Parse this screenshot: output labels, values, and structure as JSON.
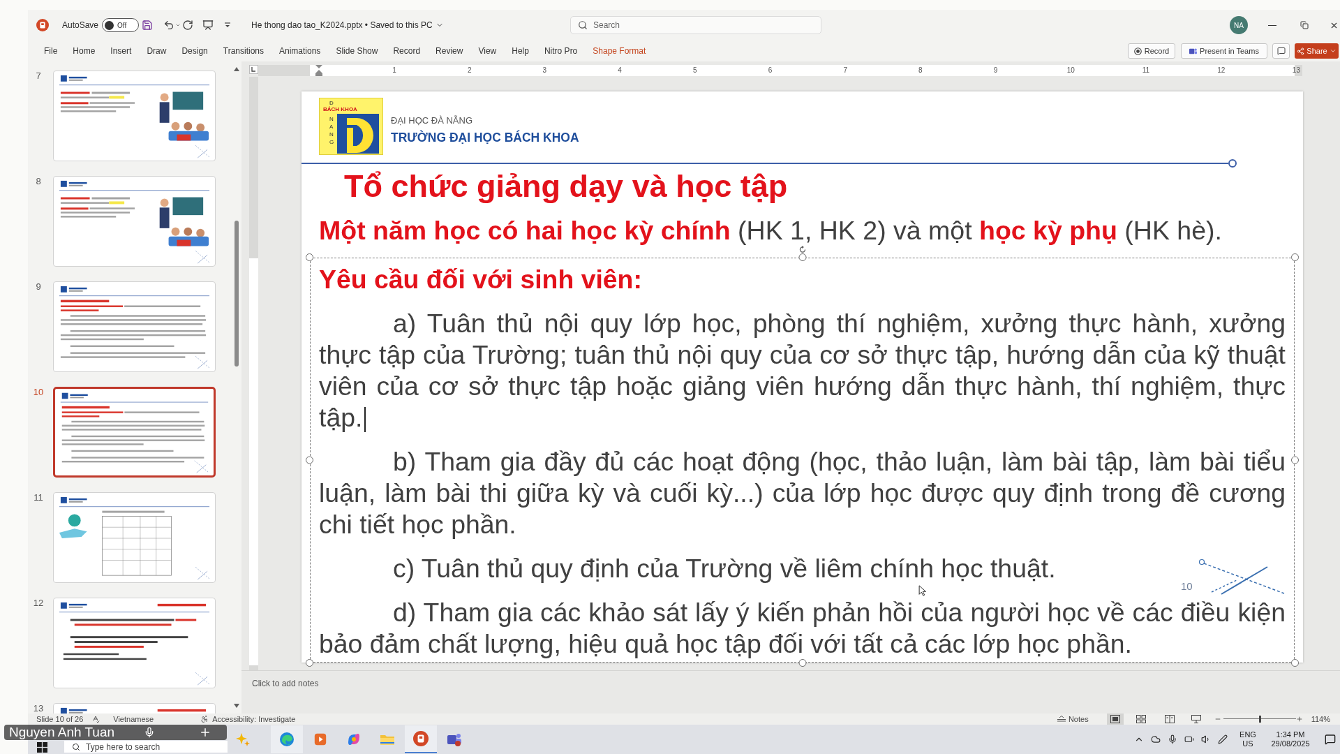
{
  "title_bar": {
    "autosave": {
      "label": "AutoSave",
      "on": false,
      "state_text": "Off"
    },
    "document": "He thong dao tao_K2024.pptx • Saved to this PC",
    "search": {
      "placeholder": "Search"
    },
    "avatar": "NA"
  },
  "ribbon": {
    "tabs": [
      {
        "label": "File",
        "kind": "standard"
      },
      {
        "label": "Home",
        "kind": "standard"
      },
      {
        "label": "Insert",
        "kind": "standard"
      },
      {
        "label": "Draw",
        "kind": "standard"
      },
      {
        "label": "Design",
        "kind": "standard"
      },
      {
        "label": "Transitions",
        "kind": "standard"
      },
      {
        "label": "Animations",
        "kind": "standard"
      },
      {
        "label": "Slide Show",
        "kind": "standard"
      },
      {
        "label": "Record",
        "kind": "standard"
      },
      {
        "label": "Review",
        "kind": "standard"
      },
      {
        "label": "View",
        "kind": "standard"
      },
      {
        "label": "Help",
        "kind": "standard"
      },
      {
        "label": "Nitro Pro",
        "kind": "standard"
      },
      {
        "label": "Shape Format",
        "kind": "contextual"
      }
    ],
    "actions": [
      {
        "kind": "record",
        "label": "Record"
      },
      {
        "kind": "teams",
        "label": "Present in Teams"
      },
      {
        "kind": "comments"
      },
      {
        "kind": "share",
        "label": "Share"
      }
    ]
  },
  "ruler": {
    "labels": [
      "1",
      "2",
      "3",
      "4",
      "5",
      "6",
      "7",
      "8",
      "9",
      "10",
      "11",
      "12",
      "13"
    ]
  },
  "thumbnails": [
    {
      "number": "7",
      "kind": "picture",
      "selected": false
    },
    {
      "number": "8",
      "kind": "picture",
      "selected": false
    },
    {
      "number": "9",
      "kind": "text",
      "selected": false
    },
    {
      "number": "10",
      "kind": "text",
      "selected": true
    },
    {
      "number": "11",
      "kind": "table",
      "selected": false
    },
    {
      "number": "12",
      "kind": "list",
      "selected": false
    },
    {
      "number": "13",
      "kind": "list",
      "selected": false
    }
  ],
  "slide": {
    "logo": {
      "mark": "Đ",
      "band": "BÁCH KHOA",
      "side": "NANG"
    },
    "university": "ĐẠI HỌC ĐÀ NẴNG",
    "school": "TRƯỜNG ĐẠI HỌC BÁCH KHOA",
    "title": "Tổ chức giảng dạy và học tập",
    "intro": "**Một năm học có hai học kỳ chính** (HK 1, HK 2) và một **học kỳ phụ** (HK hè).",
    "heading": "Yêu cầu đối với sinh viên:",
    "items": [
      {
        "text": "a) Tuân thủ nội quy lớp học, phòng thí nghiệm, xưởng thực hành, xưởng thực tập của Trường; tuân thủ nội quy của cơ sở thực tập, hướng dẫn của kỹ thuật viên của cơ sở thực tập hoặc giảng viên hướng dẫn thực hành, thí nghiệm, thực tập.",
        "cursor": true
      },
      {
        "text": "b) Tham gia đầy đủ các hoạt động (học, thảo luận, làm bài tập, làm bài tiểu luận, làm bài thi giữa kỳ và cuối kỳ...) của lớp học được quy định trong đề cương chi tiết học phần.",
        "cursor": false
      },
      {
        "text": "c) Tuân thủ quy định của Trường về liêm chính học thuật.",
        "cursor": false
      },
      {
        "text": "d) Tham gia các khảo sát lấy ý kiến phản hồi của người học về các điều kiện bảo đảm chất lượng, hiệu quả học tập đối với tất cả các lớp học phần.",
        "cursor": false
      }
    ],
    "slide_number": "10"
  },
  "notes": {
    "placeholder": "Click to add notes"
  },
  "status_bar": {
    "slide": "Slide 10 of 26",
    "language": "Vietnamese",
    "accessibility": "Accessibility: Investigate",
    "notes": "Notes",
    "views": [
      {
        "kind": "normal",
        "selected": true
      },
      {
        "kind": "sorter",
        "selected": false
      },
      {
        "kind": "reading",
        "selected": false
      },
      {
        "kind": "slideshow",
        "selected": false
      }
    ],
    "zoom": {
      "level": 0.51,
      "reading": "114%"
    }
  },
  "call_overlay": {
    "name": "Nguyen Anh Tuan"
  },
  "taskbar": {
    "search": {
      "placeholder": "Type here to search"
    },
    "language": "ENG",
    "region": "US",
    "time": "1:34 PM",
    "date": "29/08/2025"
  }
}
